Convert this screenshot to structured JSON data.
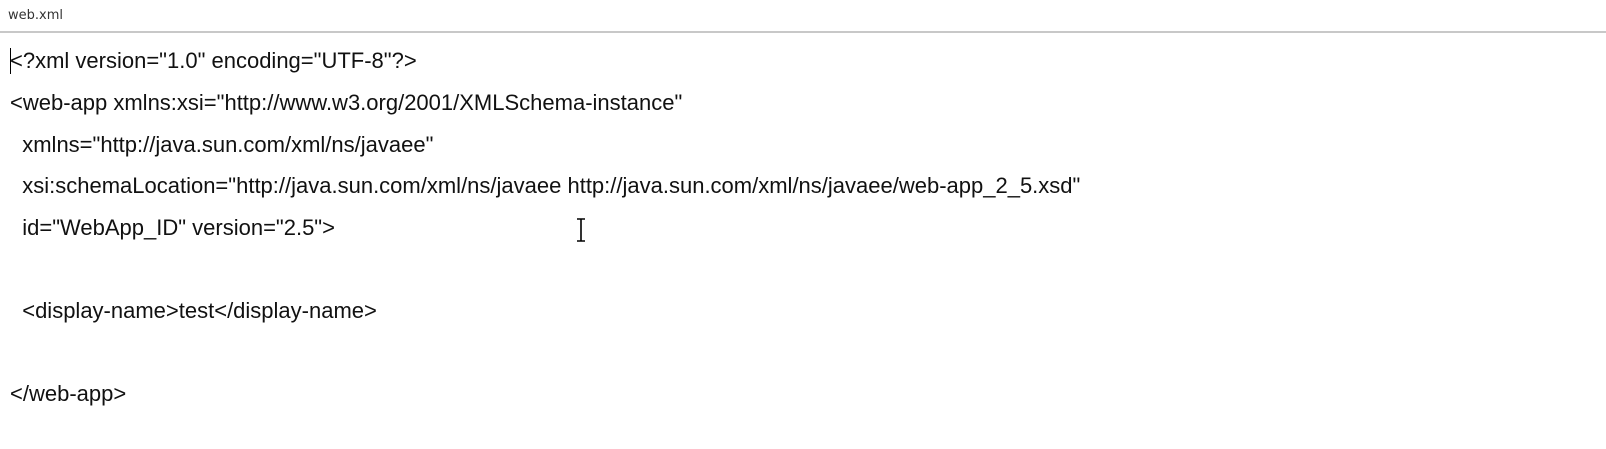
{
  "tab": {
    "filename": "web.xml"
  },
  "editor": {
    "lines": [
      "<?xml version=\"1.0\" encoding=\"UTF-8\"?>",
      "<web-app xmlns:xsi=\"http://www.w3.org/2001/XMLSchema-instance\"",
      "  xmlns=\"http://java.sun.com/xml/ns/javaee\"",
      "  xsi:schemaLocation=\"http://java.sun.com/xml/ns/javaee http://java.sun.com/xml/ns/javaee/web-app_2_5.xsd\"",
      "  id=\"WebApp_ID\" version=\"2.5\">",
      "",
      "  <display-name>test</display-name>",
      "",
      "</web-app>"
    ]
  },
  "colors": {
    "text": "#111111",
    "background": "#ffffff",
    "divider": "#c8c8c8"
  },
  "icons": {
    "mouse_cursor": "ibeam-cursor-icon"
  }
}
